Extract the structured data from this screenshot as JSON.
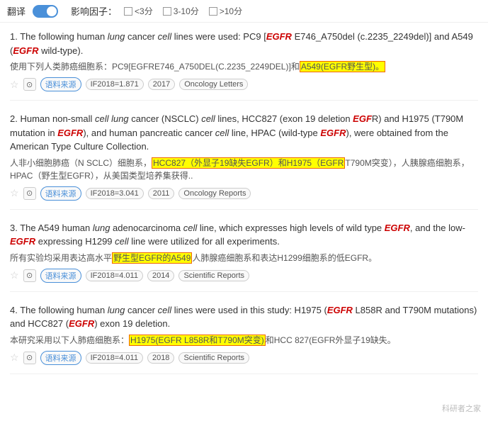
{
  "topbar": {
    "translate_label": "翻译",
    "if_label": "影响因子：",
    "checkbox1": "<3分",
    "checkbox2": "3-10分",
    "checkbox3": ">10分"
  },
  "results": [
    {
      "number": "1.",
      "en_parts": [
        {
          "text": "The following human "
        },
        {
          "text": "lung",
          "italic": true
        },
        {
          "text": " cancer "
        },
        {
          "text": "cell",
          "italic": true
        },
        {
          "text": " lines were used: PC9 ["
        },
        {
          "text": "EGFR",
          "italic_red": true
        },
        {
          "text": " E746_A750del (c.2235_2249del)] and A549 ("
        },
        {
          "text": "EGFR",
          "italic_red": true
        },
        {
          "text": " wild-type)."
        }
      ],
      "cn_parts": [
        {
          "text": "使用下列人类肺癌细胞系：PC9[EGFRE746_A750DEL(C.2235_2249DEL)]和"
        },
        {
          "text": "A549(EGFR野生型)。",
          "highlight": "yellow"
        }
      ],
      "if_val": "IF2018=1.871",
      "year": "2017",
      "journal": "Oncology Letters"
    },
    {
      "number": "2.",
      "en_parts": [
        {
          "text": "Human non-small "
        },
        {
          "text": "cell lung",
          "italic": true
        },
        {
          "text": " cancer (NSCLC) "
        },
        {
          "text": "cell",
          "italic": true
        },
        {
          "text": " lines, HCC827 (exon 19 deletion "
        },
        {
          "text": "EGF",
          "italic_red": true
        },
        {
          "text": "R) and H1975 (T790M mutation in "
        },
        {
          "text": "EGFR",
          "italic_red": true
        },
        {
          "text": "), and human pancreatic cancer "
        },
        {
          "text": "cell",
          "italic": true
        },
        {
          "text": " line, HPAC (wild-type "
        },
        {
          "text": "EGFR",
          "italic_red": true
        },
        {
          "text": "), were obtained from the American Type Culture Collection."
        }
      ],
      "cn_parts": [
        {
          "text": "人非小细胞肺癌（N SCLC）细胞系，"
        },
        {
          "text": "HCC827（外显子19缺失EGFR）和H1975（EGFR",
          "highlight": "yellow"
        },
        {
          "text": "T790M突变），人胰腺癌细胞系，HPAC（野生型EGFR），从美国类型培养集获得.."
        }
      ],
      "if_val": "IF2018=3.041",
      "year": "2011",
      "journal": "Oncology Reports"
    },
    {
      "number": "3.",
      "en_parts": [
        {
          "text": "The A549 human "
        },
        {
          "text": "lung",
          "italic": true
        },
        {
          "text": " adenocarcinoma "
        },
        {
          "text": "cell",
          "italic": true
        },
        {
          "text": " line, which expresses high levels of wild type "
        },
        {
          "text": "EGFR",
          "italic_red": true
        },
        {
          "text": ", and the low-"
        },
        {
          "text": "EGFR",
          "italic_red": true
        },
        {
          "text": " expressing H1299 "
        },
        {
          "text": "cell",
          "italic": true
        },
        {
          "text": " line were utilized for all experiments."
        }
      ],
      "cn_parts": [
        {
          "text": "所有实验均采用表达高水平"
        },
        {
          "text": "野生型EGFR的A549",
          "highlight": "yellow"
        },
        {
          "text": "人肺腺癌细胞系和表达H1299细胞系的低EGFR。"
        }
      ],
      "if_val": "IF2018=4.011",
      "year": "2014",
      "journal": "Scientific Reports"
    },
    {
      "number": "4.",
      "en_parts": [
        {
          "text": "The following human "
        },
        {
          "text": "lung",
          "italic": true
        },
        {
          "text": " cancer "
        },
        {
          "text": "cell",
          "italic": true
        },
        {
          "text": " lines were used in this study: H1975 ("
        },
        {
          "text": "EGFR",
          "italic_red": true
        },
        {
          "text": " L858R and T790M mutations) and HCC827 ("
        },
        {
          "text": "EGFR",
          "italic_red": true
        },
        {
          "text": ") exon 19 deletion."
        }
      ],
      "cn_parts": [
        {
          "text": "本研究采用以下人肺癌细胞系："
        },
        {
          "text": "H1975(EGFR L858R和T790M突变)",
          "highlight": "yellow"
        },
        {
          "text": "和HCC 827(EGFR外显子19缺失。"
        }
      ],
      "if_val": "IF2018=4.011",
      "year": "2018",
      "journal": "Scientific Reports"
    }
  ],
  "watermark": "科研者之家"
}
